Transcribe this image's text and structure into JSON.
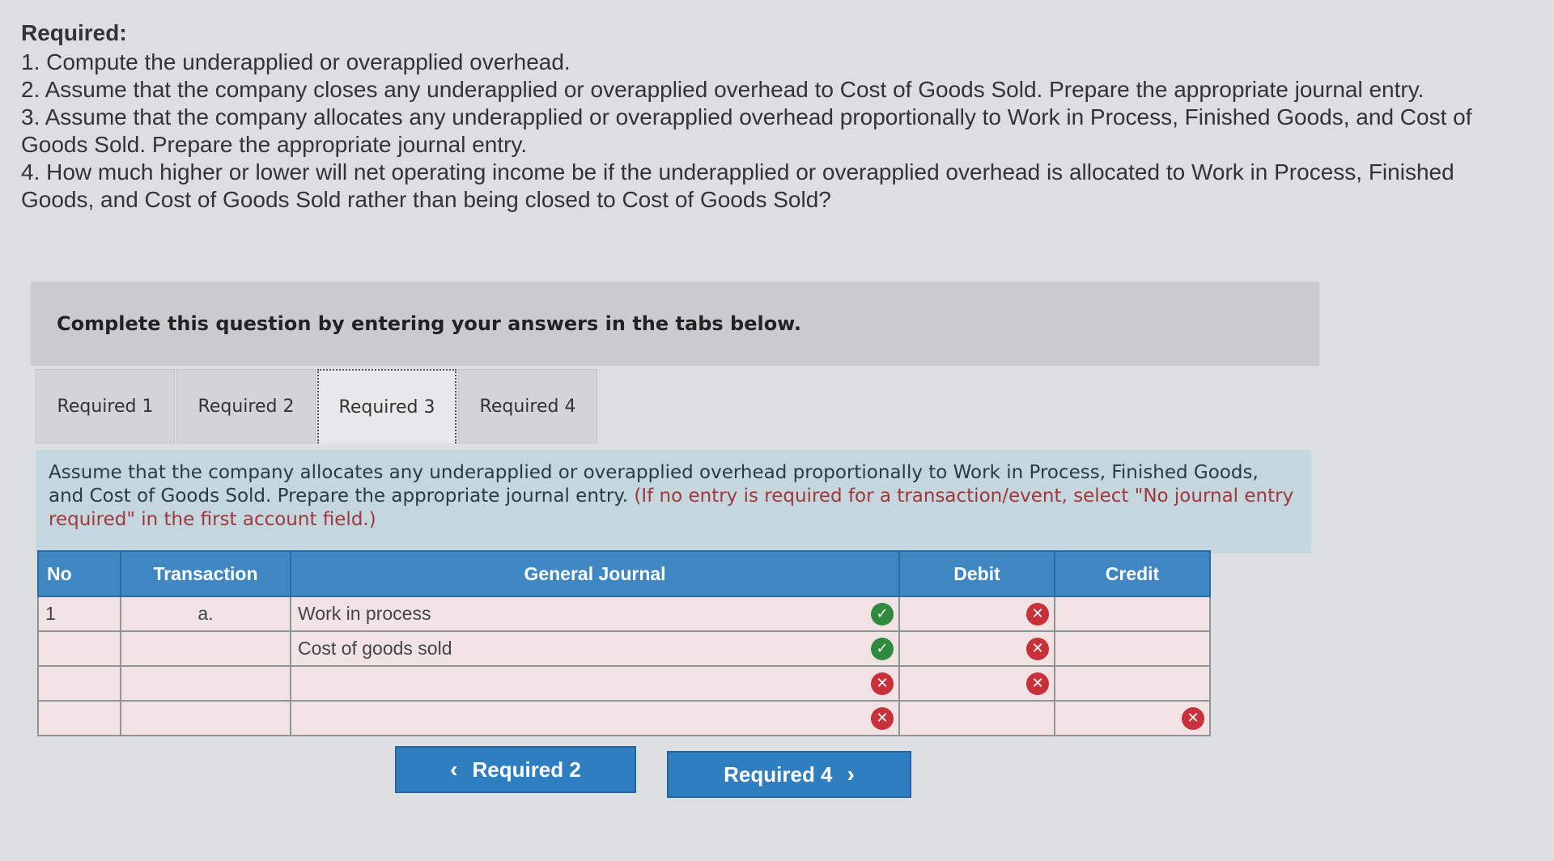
{
  "required": {
    "heading": "Required:",
    "items": [
      "1. Compute the underapplied or overapplied overhead.",
      "2. Assume that the company closes any underapplied or overapplied overhead to Cost of Goods Sold. Prepare the appropriate journal entry.",
      "3. Assume that the company allocates any underapplied or overapplied overhead proportionally to Work in Process, Finished Goods, and Cost of Goods Sold. Prepare the appropriate journal entry.",
      "4. How much higher or lower will net operating income be if the underapplied or overapplied overhead is allocated to Work in Process, Finished Goods, and Cost of Goods Sold rather than being closed to Cost of Goods Sold?"
    ]
  },
  "instruction": "Complete this question by entering your answers in the tabs below.",
  "tabs": [
    {
      "label": "Required 1",
      "active": false
    },
    {
      "label": "Required 2",
      "active": false
    },
    {
      "label": "Required 3",
      "active": true
    },
    {
      "label": "Required 4",
      "active": false
    }
  ],
  "panel": {
    "text": "Assume that the company allocates any underapplied or overapplied overhead proportionally to Work in Process, Finished Goods, and Cost of Goods Sold. Prepare the appropriate journal entry.",
    "hint": "(If no entry is required for a transaction/event, select \"No journal entry required\" in the first account field.)"
  },
  "journal": {
    "headers": {
      "no": "No",
      "transaction": "Transaction",
      "general_journal": "General Journal",
      "debit": "Debit",
      "credit": "Credit"
    },
    "rows": [
      {
        "no": "1",
        "transaction": "a.",
        "account": "Work in process",
        "debit": "",
        "credit": ""
      },
      {
        "no": "",
        "transaction": "",
        "account": "Cost of goods sold",
        "debit": "",
        "credit": ""
      },
      {
        "no": "",
        "transaction": "",
        "account": "",
        "debit": "",
        "credit": ""
      },
      {
        "no": "",
        "transaction": "",
        "account": "",
        "debit": "",
        "credit": ""
      }
    ]
  },
  "nav": {
    "prev_label": "Required 2",
    "next_label": "Required 4"
  },
  "colors": {
    "header_blue": "#3f87c3",
    "correct_green": "#2f8a3e",
    "incorrect_red": "#c8303a",
    "panel_blue": "#c4d7df"
  }
}
